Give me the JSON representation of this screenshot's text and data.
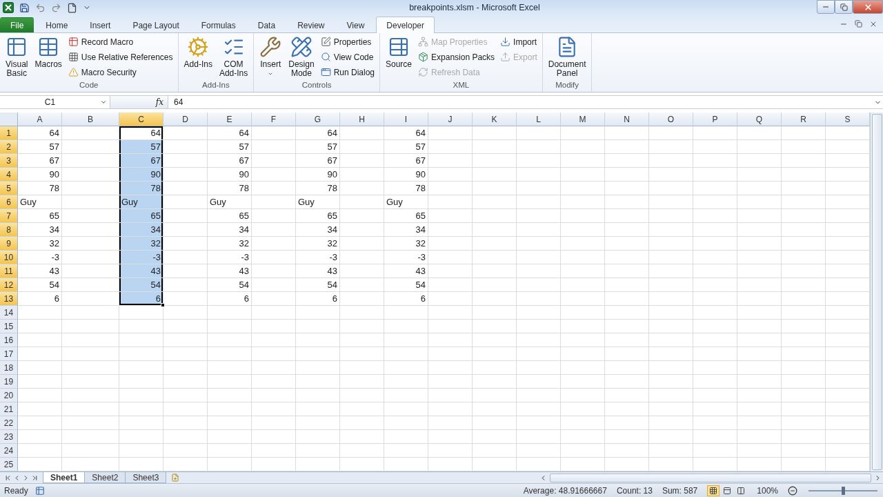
{
  "window": {
    "title": "breakpoints.xlsm - Microsoft Excel"
  },
  "tabs": [
    {
      "label": "File",
      "selected": false,
      "kind": "file"
    },
    {
      "label": "Home",
      "selected": false,
      "kind": "tab"
    },
    {
      "label": "Insert",
      "selected": false,
      "kind": "tab"
    },
    {
      "label": "Page Layout",
      "selected": false,
      "kind": "tab"
    },
    {
      "label": "Formulas",
      "selected": false,
      "kind": "tab"
    },
    {
      "label": "Data",
      "selected": false,
      "kind": "tab"
    },
    {
      "label": "Review",
      "selected": false,
      "kind": "tab"
    },
    {
      "label": "View",
      "selected": false,
      "kind": "tab"
    },
    {
      "label": "Developer",
      "selected": true,
      "kind": "tab"
    }
  ],
  "ribbon": [
    {
      "label": "Code",
      "items": [
        {
          "label": "Visual\nBasic",
          "kind": "large",
          "disabled": false,
          "has_menu": false
        },
        {
          "label": "Macros",
          "kind": "large",
          "disabled": false,
          "has_menu": false
        },
        {
          "label": "Record Macro",
          "kind": "small",
          "disabled": false
        },
        {
          "label": "Use Relative References",
          "kind": "small",
          "disabled": false
        },
        {
          "label": "Macro Security",
          "kind": "small",
          "disabled": false
        }
      ]
    },
    {
      "label": "Add-Ins",
      "items": [
        {
          "label": "Add-Ins",
          "kind": "large",
          "disabled": false,
          "has_menu": false
        },
        {
          "label": "COM\nAdd-Ins",
          "kind": "large",
          "disabled": false,
          "has_menu": false
        }
      ]
    },
    {
      "label": "Controls",
      "items": [
        {
          "label": "Insert",
          "kind": "large",
          "disabled": false,
          "has_menu": true
        },
        {
          "label": "Design\nMode",
          "kind": "large",
          "disabled": false,
          "has_menu": false
        },
        {
          "label": "Properties",
          "kind": "small",
          "disabled": false
        },
        {
          "label": "View Code",
          "kind": "small",
          "disabled": false
        },
        {
          "label": "Run Dialog",
          "kind": "small",
          "disabled": false
        }
      ]
    },
    {
      "label": "XML",
      "items": [
        {
          "label": "Source",
          "kind": "large",
          "disabled": false,
          "has_menu": false
        },
        {
          "label": "Map Properties",
          "kind": "small",
          "disabled": true
        },
        {
          "label": "Expansion Packs",
          "kind": "small",
          "disabled": false
        },
        {
          "label": "Refresh Data",
          "kind": "small",
          "disabled": true
        },
        {
          "label": "Import",
          "kind": "small",
          "disabled": false
        },
        {
          "label": "Export",
          "kind": "small",
          "disabled": true
        }
      ]
    },
    {
      "label": "Modify",
      "items": [
        {
          "label": "Document\nPanel",
          "kind": "large",
          "disabled": false,
          "has_menu": false
        }
      ]
    }
  ],
  "formula_bar": {
    "name_box": "C1",
    "function_symbol": "fx",
    "value": "64"
  },
  "columns": [
    {
      "label": "A",
      "selected": false
    },
    {
      "label": "B",
      "selected": false
    },
    {
      "label": "C",
      "selected": true
    },
    {
      "label": "D",
      "selected": false
    },
    {
      "label": "E",
      "selected": false
    },
    {
      "label": "F",
      "selected": false
    },
    {
      "label": "G",
      "selected": false
    },
    {
      "label": "H",
      "selected": false
    },
    {
      "label": "I",
      "selected": false
    },
    {
      "label": "J",
      "selected": false
    },
    {
      "label": "K",
      "selected": false
    },
    {
      "label": "L",
      "selected": false
    },
    {
      "label": "M",
      "selected": false
    },
    {
      "label": "N",
      "selected": false
    },
    {
      "label": "O",
      "selected": false
    },
    {
      "label": "P",
      "selected": false
    },
    {
      "label": "Q",
      "selected": false
    },
    {
      "label": "R",
      "selected": false
    },
    {
      "label": "S",
      "selected": false
    }
  ],
  "rows": [
    {
      "label": "1",
      "selected": true,
      "cells": [
        {
          "value": "64",
          "kind": "number",
          "selected": false,
          "active": false
        },
        null,
        {
          "value": "64",
          "kind": "number",
          "selected": true,
          "active": true
        },
        null,
        {
          "value": "64",
          "kind": "number",
          "selected": false,
          "active": false
        },
        null,
        {
          "value": "64",
          "kind": "number",
          "selected": false,
          "active": false
        },
        null,
        {
          "value": "64",
          "kind": "number",
          "selected": false,
          "active": false
        }
      ]
    },
    {
      "label": "2",
      "selected": true,
      "cells": [
        {
          "value": "57",
          "kind": "number",
          "selected": false,
          "active": false
        },
        null,
        {
          "value": "57",
          "kind": "number",
          "selected": true,
          "active": false
        },
        null,
        {
          "value": "57",
          "kind": "number",
          "selected": false,
          "active": false
        },
        null,
        {
          "value": "57",
          "kind": "number",
          "selected": false,
          "active": false
        },
        null,
        {
          "value": "57",
          "kind": "number",
          "selected": false,
          "active": false
        }
      ]
    },
    {
      "label": "3",
      "selected": true,
      "cells": [
        {
          "value": "67",
          "kind": "number",
          "selected": false,
          "active": false
        },
        null,
        {
          "value": "67",
          "kind": "number",
          "selected": true,
          "active": false
        },
        null,
        {
          "value": "67",
          "kind": "number",
          "selected": false,
          "active": false
        },
        null,
        {
          "value": "67",
          "kind": "number",
          "selected": false,
          "active": false
        },
        null,
        {
          "value": "67",
          "kind": "number",
          "selected": false,
          "active": false
        }
      ]
    },
    {
      "label": "4",
      "selected": true,
      "cells": [
        {
          "value": "90",
          "kind": "number",
          "selected": false,
          "active": false
        },
        null,
        {
          "value": "90",
          "kind": "number",
          "selected": true,
          "active": false
        },
        null,
        {
          "value": "90",
          "kind": "number",
          "selected": false,
          "active": false
        },
        null,
        {
          "value": "90",
          "kind": "number",
          "selected": false,
          "active": false
        },
        null,
        {
          "value": "90",
          "kind": "number",
          "selected": false,
          "active": false
        }
      ]
    },
    {
      "label": "5",
      "selected": true,
      "cells": [
        {
          "value": "78",
          "kind": "number",
          "selected": false,
          "active": false
        },
        null,
        {
          "value": "78",
          "kind": "number",
          "selected": true,
          "active": false
        },
        null,
        {
          "value": "78",
          "kind": "number",
          "selected": false,
          "active": false
        },
        null,
        {
          "value": "78",
          "kind": "number",
          "selected": false,
          "active": false
        },
        null,
        {
          "value": "78",
          "kind": "number",
          "selected": false,
          "active": false
        }
      ]
    },
    {
      "label": "6",
      "selected": true,
      "cells": [
        {
          "value": "Guy",
          "kind": "text",
          "selected": false,
          "active": false
        },
        null,
        {
          "value": "Guy",
          "kind": "text",
          "selected": true,
          "active": false
        },
        null,
        {
          "value": "Guy",
          "kind": "text",
          "selected": false,
          "active": false
        },
        null,
        {
          "value": "Guy",
          "kind": "text",
          "selected": false,
          "active": false
        },
        null,
        {
          "value": "Guy",
          "kind": "text",
          "selected": false,
          "active": false
        }
      ]
    },
    {
      "label": "7",
      "selected": true,
      "cells": [
        {
          "value": "65",
          "kind": "number",
          "selected": false,
          "active": false
        },
        null,
        {
          "value": "65",
          "kind": "number",
          "selected": true,
          "active": false
        },
        null,
        {
          "value": "65",
          "kind": "number",
          "selected": false,
          "active": false
        },
        null,
        {
          "value": "65",
          "kind": "number",
          "selected": false,
          "active": false
        },
        null,
        {
          "value": "65",
          "kind": "number",
          "selected": false,
          "active": false
        }
      ]
    },
    {
      "label": "8",
      "selected": true,
      "cells": [
        {
          "value": "34",
          "kind": "number",
          "selected": false,
          "active": false
        },
        null,
        {
          "value": "34",
          "kind": "number",
          "selected": true,
          "active": false
        },
        null,
        {
          "value": "34",
          "kind": "number",
          "selected": false,
          "active": false
        },
        null,
        {
          "value": "34",
          "kind": "number",
          "selected": false,
          "active": false
        },
        null,
        {
          "value": "34",
          "kind": "number",
          "selected": false,
          "active": false
        }
      ]
    },
    {
      "label": "9",
      "selected": true,
      "cells": [
        {
          "value": "32",
          "kind": "number",
          "selected": false,
          "active": false
        },
        null,
        {
          "value": "32",
          "kind": "number",
          "selected": true,
          "active": false
        },
        null,
        {
          "value": "32",
          "kind": "number",
          "selected": false,
          "active": false
        },
        null,
        {
          "value": "32",
          "kind": "number",
          "selected": false,
          "active": false
        },
        null,
        {
          "value": "32",
          "kind": "number",
          "selected": false,
          "active": false
        }
      ]
    },
    {
      "label": "10",
      "selected": true,
      "cells": [
        {
          "value": "-3",
          "kind": "number",
          "selected": false,
          "active": false
        },
        null,
        {
          "value": "-3",
          "kind": "number",
          "selected": true,
          "active": false
        },
        null,
        {
          "value": "-3",
          "kind": "number",
          "selected": false,
          "active": false
        },
        null,
        {
          "value": "-3",
          "kind": "number",
          "selected": false,
          "active": false
        },
        null,
        {
          "value": "-3",
          "kind": "number",
          "selected": false,
          "active": false
        }
      ]
    },
    {
      "label": "11",
      "selected": true,
      "cells": [
        {
          "value": "43",
          "kind": "number",
          "selected": false,
          "active": false
        },
        null,
        {
          "value": "43",
          "kind": "number",
          "selected": true,
          "active": false
        },
        null,
        {
          "value": "43",
          "kind": "number",
          "selected": false,
          "active": false
        },
        null,
        {
          "value": "43",
          "kind": "number",
          "selected": false,
          "active": false
        },
        null,
        {
          "value": "43",
          "kind": "number",
          "selected": false,
          "active": false
        }
      ]
    },
    {
      "label": "12",
      "selected": true,
      "cells": [
        {
          "value": "54",
          "kind": "number",
          "selected": false,
          "active": false
        },
        null,
        {
          "value": "54",
          "kind": "number",
          "selected": true,
          "active": false
        },
        null,
        {
          "value": "54",
          "kind": "number",
          "selected": false,
          "active": false
        },
        null,
        {
          "value": "54",
          "kind": "number",
          "selected": false,
          "active": false
        },
        null,
        {
          "value": "54",
          "kind": "number",
          "selected": false,
          "active": false
        }
      ]
    },
    {
      "label": "13",
      "selected": true,
      "cells": [
        {
          "value": "6",
          "kind": "number",
          "selected": false,
          "active": false
        },
        null,
        {
          "value": "6",
          "kind": "number",
          "selected": true,
          "active": false
        },
        null,
        {
          "value": "6",
          "kind": "number",
          "selected": false,
          "active": false
        },
        null,
        {
          "value": "6",
          "kind": "number",
          "selected": false,
          "active": false
        },
        null,
        {
          "value": "6",
          "kind": "number",
          "selected": false,
          "active": false
        }
      ]
    },
    {
      "label": "14",
      "selected": false
    },
    {
      "label": "15",
      "selected": false
    },
    {
      "label": "16",
      "selected": false
    },
    {
      "label": "17",
      "selected": false
    },
    {
      "label": "18",
      "selected": false
    },
    {
      "label": "19",
      "selected": false
    },
    {
      "label": "20",
      "selected": false
    },
    {
      "label": "21",
      "selected": false
    },
    {
      "label": "22",
      "selected": false
    },
    {
      "label": "23",
      "selected": false
    },
    {
      "label": "24",
      "selected": false
    },
    {
      "label": "25",
      "selected": false
    }
  ],
  "sheets": [
    {
      "label": "Sheet1",
      "selected": true
    },
    {
      "label": "Sheet2",
      "selected": false
    },
    {
      "label": "Sheet3",
      "selected": false
    }
  ],
  "status_bar": {
    "mode": "Ready",
    "average": "Average: 48.91666667",
    "count": "Count: 13",
    "sum": "Sum: 587",
    "views": [
      {
        "selected": true
      },
      {
        "selected": false
      },
      {
        "selected": false
      }
    ],
    "zoom": "100%",
    "zoom_slider": {
      "level": 0.5
    }
  }
}
